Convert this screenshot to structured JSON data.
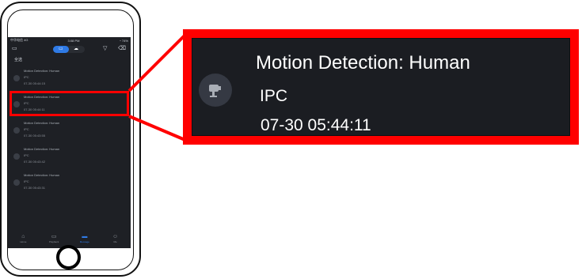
{
  "phone": {
    "status": {
      "left": "中华电信 4G",
      "center": "3:08 PM",
      "right": "◔ 74%"
    },
    "nav": {
      "select_all": "全选"
    },
    "events": [
      {
        "title": "Motion Detection: Human",
        "source": "IPC",
        "time": "07-30 05:44:15"
      },
      {
        "title": "Motion Detection: Human",
        "source": "IPC",
        "time": "07-30 05:44:11"
      },
      {
        "title": "Motion Detection: Human",
        "source": "IPC",
        "time": "07-30 05:43:55"
      },
      {
        "title": "Motion Detection: Human",
        "source": "IPC",
        "time": "07-30 05:43:42"
      },
      {
        "title": "Motion Detection: Human",
        "source": "IPC",
        "time": "07-30 05:43:31"
      }
    ],
    "tabs": [
      {
        "icon": "⌂",
        "label": "Home"
      },
      {
        "icon": "▭",
        "label": "Playback"
      },
      {
        "icon": "▬",
        "label": "Message"
      },
      {
        "icon": "☺",
        "label": "Me"
      }
    ]
  },
  "callout": {
    "title": "Motion Detection: Human",
    "source": "IPC",
    "time": "07-30 05:44:11"
  },
  "colors": {
    "highlight": "#ff0000",
    "screen_bg": "#1e2025",
    "accent": "#2f7ae5"
  }
}
